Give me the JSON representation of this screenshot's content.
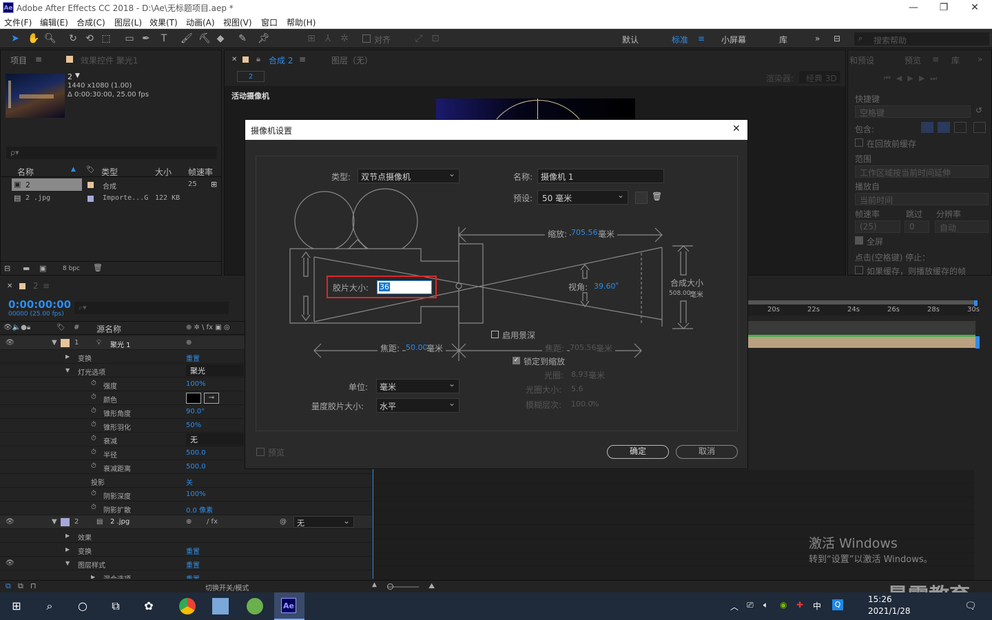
{
  "window": {
    "app_icon": "Ae",
    "title": "Adobe After Effects CC 2018 - D:\\Ae\\无标题项目.aep *",
    "minimize": "—",
    "restore": "❐",
    "close": "✕"
  },
  "menu": [
    "文件(F)",
    "编辑(E)",
    "合成(C)",
    "图层(L)",
    "效果(T)",
    "动画(A)",
    "视图(V)",
    "窗口",
    "帮助(H)"
  ],
  "toolbar": {
    "align_label": "对齐",
    "workspaces": [
      "默认",
      "标准",
      "小屏幕",
      "库"
    ],
    "active_workspace": "标准",
    "search_placeholder": "搜索帮助"
  },
  "project_panel": {
    "tab_project": "项目",
    "tab_effects": "效果控件 聚光1",
    "comp_name": "2",
    "comp_size": "1440 x1080 (1.00)",
    "comp_duration": "Δ 0:00:30:00, 25.00 fps",
    "search_placeholder": "ρ▾",
    "columns": [
      "名称",
      "类型",
      "大小",
      "帧速率"
    ],
    "rows": [
      {
        "name": "2",
        "type": "合成",
        "size": "",
        "fps": "25"
      },
      {
        "name": "2 .jpg",
        "type": "Importe...G",
        "size": "122 KB",
        "fps": ""
      }
    ],
    "bpc": "8 bpc"
  },
  "composition_panel": {
    "tab_comp": "合成 2",
    "tab_layer": "图层（无）",
    "sub_tab": "2",
    "camera_label": "活动摄像机",
    "renderer_label": "渲染器:",
    "renderer_value": "经典 3D"
  },
  "right_panel": {
    "tab_info": "和预设",
    "tab_preview": "预览",
    "tab_lib": "库",
    "shortcut_label": "快捷键",
    "shortcut_value": "空格键",
    "include_label": "包含:",
    "cache_label": "在回放前缓存",
    "range_label": "范围",
    "range_value": "工作区域按当前时间延伸",
    "play_from_label": "播放自",
    "play_from_value": "当前时间",
    "fps_label": "帧速率",
    "skip_label": "跳过",
    "res_label": "分辨率",
    "fps_value": "(25)",
    "skip_value": "0",
    "res_value": "自动",
    "fullscreen_label": "全屏",
    "stop_label": "点击(空格键) 停止：",
    "cache_stop_label": "如果缓存，则播放缓存的帧"
  },
  "timeline": {
    "tab": "2",
    "timecode": "0:00:00:00",
    "frame_info": "00000 (25.00 fps)",
    "col_source": "源名称",
    "ruler_ticks": [
      "20s",
      "22s",
      "24s",
      "26s",
      "28s",
      "30s"
    ],
    "layers": [
      {
        "num": "1",
        "name": "聚光 1",
        "depth": 0,
        "type": "layer"
      },
      {
        "name": "变换",
        "depth": 1,
        "value": "重置",
        "type": "group"
      },
      {
        "name": "灯光选项",
        "depth": 1,
        "value": "聚光",
        "type": "group-open"
      },
      {
        "name": "强度",
        "depth": 2,
        "value": "100%",
        "type": "prop"
      },
      {
        "name": "颜色",
        "depth": 2,
        "value": "",
        "type": "color"
      },
      {
        "name": "锥形角度",
        "depth": 2,
        "value": "90.0°",
        "type": "prop"
      },
      {
        "name": "锥形羽化",
        "depth": 2,
        "value": "50%",
        "type": "prop"
      },
      {
        "name": "衰减",
        "depth": 2,
        "value": "无",
        "type": "dropdown"
      },
      {
        "name": "半径",
        "depth": 2,
        "value": "500.0",
        "type": "prop"
      },
      {
        "name": "衰减距离",
        "depth": 2,
        "value": "500.0",
        "type": "prop"
      },
      {
        "name": "投影",
        "depth": 2,
        "value": "关",
        "type": "plain"
      },
      {
        "name": "阴影深度",
        "depth": 2,
        "value": "100%",
        "type": "prop"
      },
      {
        "name": "阴影扩散",
        "depth": 2,
        "value": "0.0 像素",
        "type": "prop"
      },
      {
        "num": "2",
        "name": "2 .jpg",
        "depth": 0,
        "value": "无",
        "type": "layer2"
      },
      {
        "name": "效果",
        "depth": 1,
        "value": "",
        "type": "group"
      },
      {
        "name": "变换",
        "depth": 1,
        "value": "重置",
        "type": "group"
      },
      {
        "name": "图层样式",
        "depth": 1,
        "value": "重置",
        "type": "group-open"
      },
      {
        "name": "混合选项",
        "depth": 2,
        "value": "重置",
        "type": "group"
      }
    ],
    "footer_toggle": "切换开关/模式"
  },
  "dialog": {
    "title": "摄像机设置",
    "type_label": "类型:",
    "type_value": "双节点摄像机",
    "name_label": "名称:",
    "name_value": "摄像机 1",
    "preset_label": "预设:",
    "preset_value": "50 毫米",
    "zoom_label": "缩放:",
    "zoom_value": "705.56",
    "zoom_unit": "毫米",
    "film_size_label": "胶片大小:",
    "film_size_value": "36",
    "angle_label": "视角:",
    "angle_value": "39.60",
    "angle_unit": "°",
    "comp_size_label": "合成大小",
    "comp_size_value": "508.00",
    "comp_size_unit": "毫米",
    "focal_label": "焦距:",
    "focal_value": "50.00",
    "focal_unit": "毫米",
    "dof_label": "启用景深",
    "focus_dist_label": "焦距:",
    "focus_dist_value": "705.56",
    "focus_dist_unit": "毫米",
    "lock_zoom_label": "锁定到缩放",
    "aperture_label": "光圈:",
    "aperture_value": "8.93",
    "aperture_unit": "毫米",
    "fstop_label": "光圈大小:",
    "fstop_value": "5.6",
    "blur_label": "模糊层次:",
    "blur_value": "100.0",
    "blur_unit": "%",
    "units_label": "单位:",
    "units_value": "毫米",
    "measure_label": "量度胶片大小:",
    "measure_value": "水平",
    "preview_label": "预览",
    "ok": "确定",
    "cancel": "取消",
    "highlight_color": "#e0262a"
  },
  "watermark": {
    "line1": "激活 Windows",
    "line2": "转到“设置”以激活 Windows。",
    "brand": "最需教育"
  },
  "taskbar": {
    "time": "15:26",
    "date": "2021/1/28",
    "ime": "中",
    "ae_label": "Ae"
  }
}
